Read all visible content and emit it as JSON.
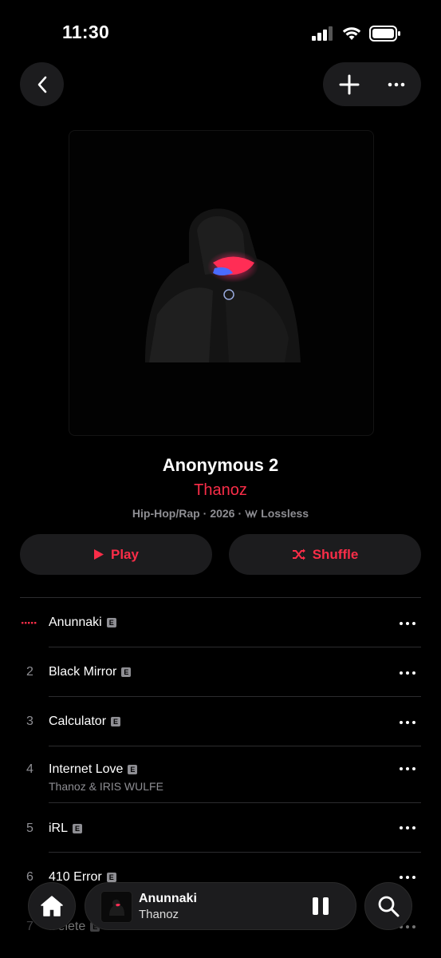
{
  "status_bar": {
    "time": "11:30"
  },
  "album": {
    "title": "Anonymous 2",
    "artist": "Thanoz",
    "genre": "Hip-Hop/Rap",
    "year": "2026",
    "separator": "·",
    "quality": "Lossless"
  },
  "actions": {
    "play_label": "Play",
    "shuffle_label": "Shuffle"
  },
  "explicit_badge": "E",
  "tracks": [
    {
      "number": "",
      "title": "Anunnaki",
      "explicit": true,
      "playing": true
    },
    {
      "number": "2",
      "title": "Black Mirror",
      "explicit": true
    },
    {
      "number": "3",
      "title": "Calculator",
      "explicit": true
    },
    {
      "number": "4",
      "title": "Internet Love",
      "explicit": true,
      "subtitle": "Thanoz & IRIS WULFE"
    },
    {
      "number": "5",
      "title": "iRL",
      "explicit": true
    },
    {
      "number": "6",
      "title": "410 Error",
      "explicit": true
    },
    {
      "number": "7",
      "title": "Delete",
      "explicit": true
    }
  ],
  "now_playing": {
    "title": "Anunnaki",
    "artist": "Thanoz"
  },
  "colors": {
    "accent": "#fa2d48",
    "background": "#000000",
    "surface": "#1c1c1e",
    "secondary_text": "#8e8e93"
  },
  "icons": [
    "back-chevron-icon",
    "plus-icon",
    "more-icon",
    "play-icon",
    "shuffle-icon",
    "home-icon",
    "search-icon",
    "pause-icon",
    "lossless-icon",
    "cellular-signal-icon",
    "wifi-icon",
    "battery-icon"
  ]
}
